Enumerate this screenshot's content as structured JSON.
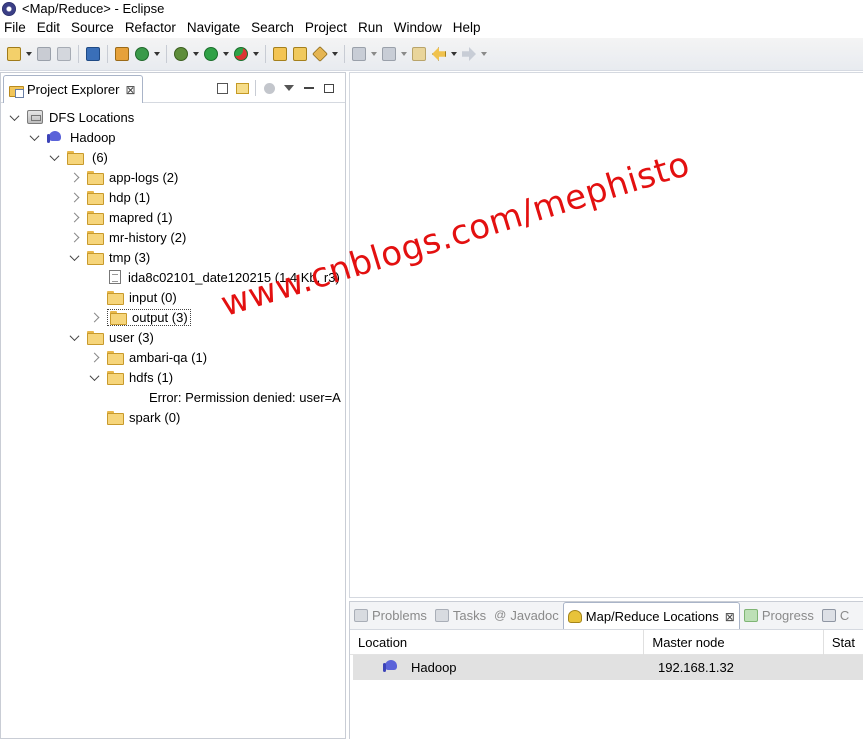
{
  "window": {
    "title": "<Map/Reduce> - Eclipse"
  },
  "menubar": {
    "items": [
      "File",
      "Edit",
      "Source",
      "Refactor",
      "Navigate",
      "Search",
      "Project",
      "Run",
      "Window",
      "Help"
    ]
  },
  "explorer": {
    "tab_label": "Project Explorer",
    "tab_close": "⊠",
    "tree": [
      {
        "label": "DFS Locations"
      },
      {
        "label": "Hadoop"
      },
      {
        "label": "(6)"
      },
      {
        "label": "app-logs (2)"
      },
      {
        "label": "hdp (1)"
      },
      {
        "label": "mapred (1)"
      },
      {
        "label": "mr-history (2)"
      },
      {
        "label": "tmp (3)"
      },
      {
        "label": "ida8c02101_date120215 (1.4 Kb, r3)"
      },
      {
        "label": "input (0)"
      },
      {
        "label": "output (3)"
      },
      {
        "label": "user (3)"
      },
      {
        "label": "ambari-qa (1)"
      },
      {
        "label": "hdfs (1)"
      },
      {
        "label": "Error: Permission denied: user=A"
      },
      {
        "label": "spark (0)"
      }
    ]
  },
  "bottom_panel": {
    "tabs": [
      "Problems",
      "Tasks",
      "Javadoc",
      "Map/Reduce Locations",
      "Progress",
      "C"
    ],
    "active_tab_close": "⊠",
    "columns": [
      "Location",
      "Master node",
      "Stat"
    ],
    "rows": [
      {
        "location": "Hadoop",
        "master_node": "192.168.1.32"
      }
    ]
  },
  "watermark": {
    "text": "www.cnblogs.com/mephisto"
  },
  "colors": {
    "accent": "#5b63d9",
    "watermark": "#e31010",
    "folder": "#f6d57a"
  }
}
